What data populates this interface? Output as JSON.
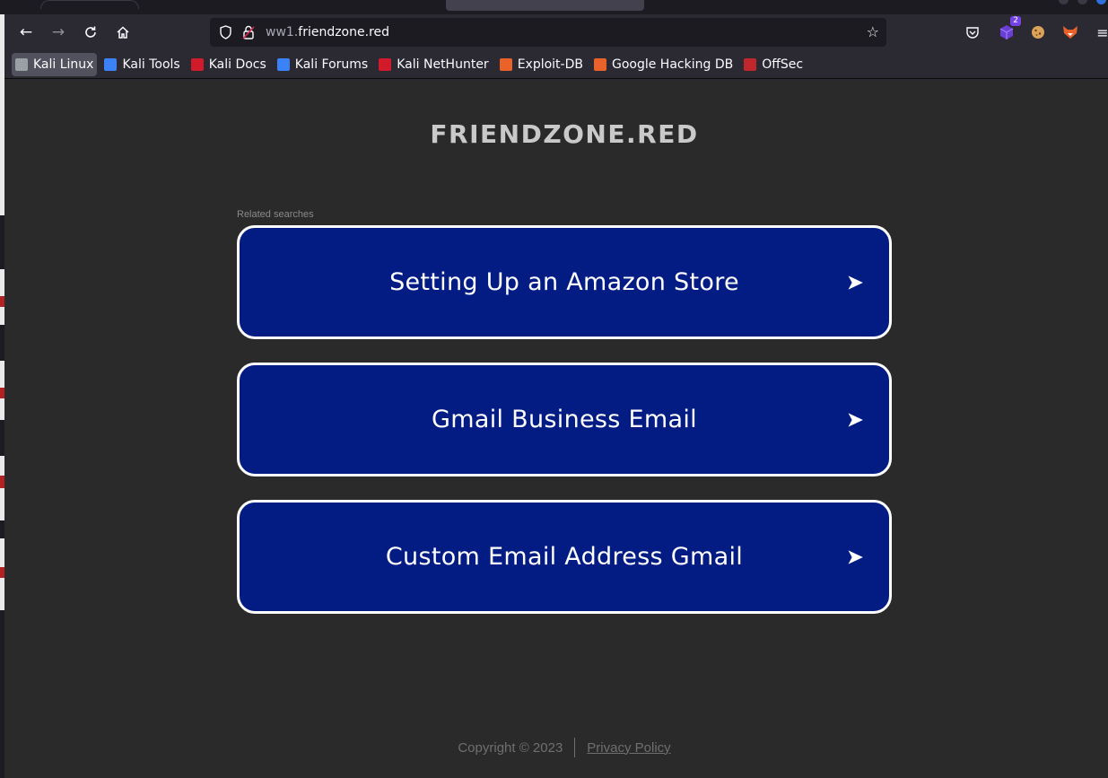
{
  "browser": {
    "url_prefix": "ww1.",
    "url_domain": "friendzone.red",
    "extension_badge": "2"
  },
  "bookmarks": [
    {
      "label": "Kali Linux",
      "icon": "kali-dragon-icon",
      "color": "#9aa0a6"
    },
    {
      "label": "Kali Tools",
      "icon": "kali-tools-icon",
      "color": "#3b82f6"
    },
    {
      "label": "Kali Docs",
      "icon": "kali-docs-icon",
      "color": "#d11a2a"
    },
    {
      "label": "Kali Forums",
      "icon": "kali-forums-icon",
      "color": "#3b82f6"
    },
    {
      "label": "Kali NetHunter",
      "icon": "nethunter-icon",
      "color": "#d11a2a"
    },
    {
      "label": "Exploit-DB",
      "icon": "exploit-db-icon",
      "color": "#e8622a"
    },
    {
      "label": "Google Hacking DB",
      "icon": "ghdb-icon",
      "color": "#e8622a"
    },
    {
      "label": "OffSec",
      "icon": "offsec-icon",
      "color": "#c0272d"
    }
  ],
  "page": {
    "title": "FRIENDZONE.RED",
    "related_label": "Related searches",
    "ads": [
      {
        "label": "Setting Up an Amazon Store",
        "arrow": "➤"
      },
      {
        "label": "Gmail Business Email",
        "arrow": "➤"
      },
      {
        "label": "Custom Email Address Gmail",
        "arrow": "➤"
      }
    ],
    "copyright": "Copyright © 2023",
    "privacy": "Privacy Policy"
  },
  "colors": {
    "page_bg": "#2b2a2a",
    "ad_bg": "#021c84",
    "title": "#c9c9c9"
  }
}
